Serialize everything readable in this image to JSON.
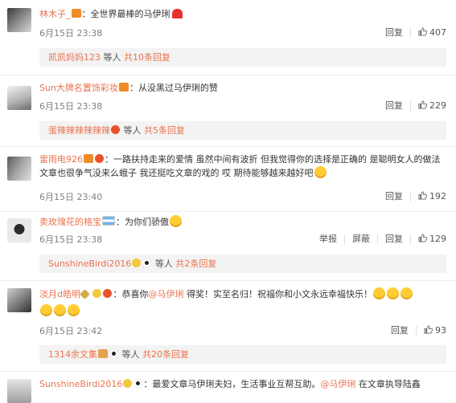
{
  "comments": [
    {
      "user": "林木子_",
      "colon": "：",
      "text": "全世界最棒的马伊琍",
      "time": "6月15日 23:38",
      "reply_label": "回复",
      "like_count": "407",
      "replies_summary": {
        "user": "凯凯妈妈123",
        "middle": "等人",
        "count": "共10条回复"
      }
    },
    {
      "user": "Sun大牌名置饰彩妆",
      "colon": "：",
      "text": "从没黑过马伊琍的赞",
      "time": "6月15日 23:38",
      "reply_label": "回复",
      "like_count": "229",
      "replies_summary": {
        "user": "蛋辣辣辣辣辣辣",
        "middle": "等人",
        "count": "共5条回复"
      }
    },
    {
      "user": "雷雨电926",
      "colon": "：",
      "text": "一路扶持走来的爱情 虽然中间有波折 但我觉得你的选择是正确的 是聪明女人的做法 文章也很争气没来么蛾子 我还挺吃文章的戏的 哎 期待能够越来越好吧",
      "time": "6月15日 23:40",
      "reply_label": "回复",
      "like_count": "192"
    },
    {
      "user": "卖玫瑰花的格宝",
      "colon": "：",
      "text": "为你们骄傲",
      "time": "6月15日 23:38",
      "report_label": "举报",
      "block_label": "屏蔽",
      "reply_label": "回复",
      "like_count": "129",
      "replies_summary": {
        "user": "SunshineBirdi2016",
        "middle": "等人",
        "count": "共2条回复"
      }
    },
    {
      "user": "淡月d皓明",
      "colon": "：",
      "text": "恭喜你",
      "mention": "@马伊琍",
      "text2": " 得奖！实至名归！祝福你和小文永远幸福快乐！",
      "time": "6月15日 23:42",
      "reply_label": "回复",
      "like_count": "93",
      "replies_summary": {
        "user": "1314余文集",
        "middle": "等人",
        "count": "共20条回复"
      }
    },
    {
      "user": "SunshineBirdi2016",
      "colon": "：",
      "text": "最爱文章马伊琍夫妇，生活事业互帮互助。",
      "mention": "@马伊琍",
      "text2": " 在文章执导陆鑫"
    }
  ],
  "colors": {
    "username": "#eb7350",
    "meta": "#808080",
    "reply_panel": "#f3f3f3"
  },
  "icons": [
    "thumbs-up-icon",
    "vip-badge-icon",
    "emoji-icon",
    "heart-icon"
  ]
}
